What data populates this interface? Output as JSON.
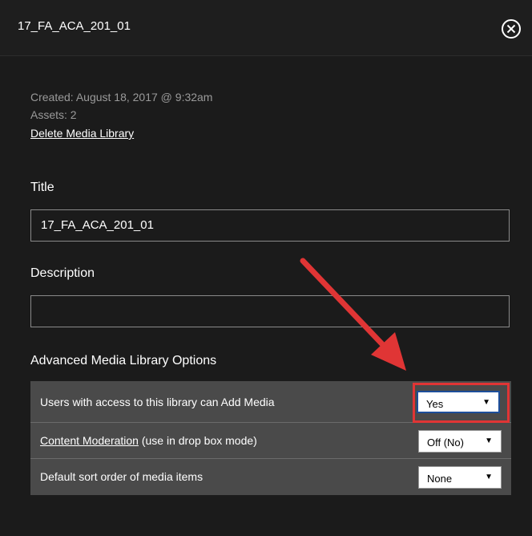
{
  "header": {
    "title": "17_FA_ACA_201_01"
  },
  "meta": {
    "created": "Created: August 18, 2017 @ 9:32am",
    "assets": "Assets: 2",
    "delete_link": "Delete Media Library"
  },
  "form": {
    "title_label": "Title",
    "title_value": "17_FA_ACA_201_01",
    "description_label": "Description",
    "description_value": "",
    "advanced_heading": "Advanced Media Library Options"
  },
  "options": [
    {
      "label": "Users with access to this library can Add Media",
      "value": "Yes"
    },
    {
      "link_label": "Content Moderation",
      "label_rest": " (use in drop box mode)",
      "value": "Off (No)"
    },
    {
      "label": "Default sort order of media items",
      "value": "None"
    }
  ],
  "colors": {
    "annotation": "#e03535",
    "background": "#1b1b1b",
    "table": "#4a4a4a"
  }
}
